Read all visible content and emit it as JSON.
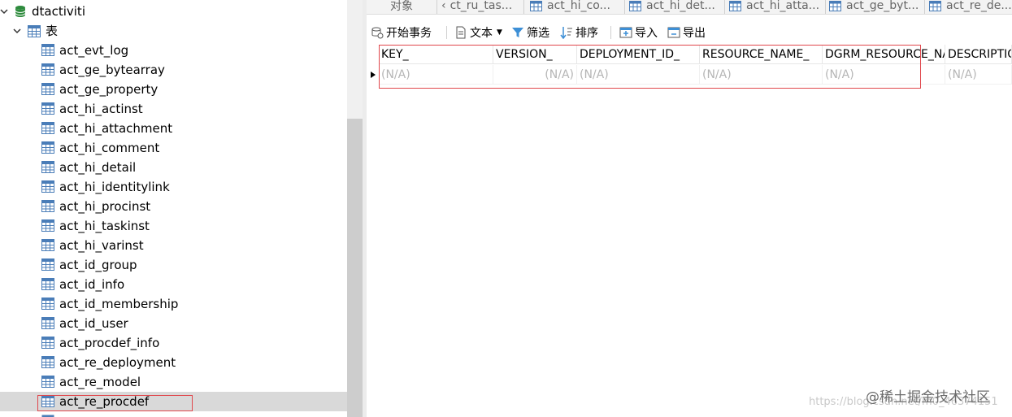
{
  "tree": {
    "database": "dtactiviti",
    "folder": "表",
    "tables": [
      "act_evt_log",
      "act_ge_bytearray",
      "act_ge_property",
      "act_hi_actinst",
      "act_hi_attachment",
      "act_hi_comment",
      "act_hi_detail",
      "act_hi_identitylink",
      "act_hi_procinst",
      "act_hi_taskinst",
      "act_hi_varinst",
      "act_id_group",
      "act_id_info",
      "act_id_membership",
      "act_id_user",
      "act_procdef_info",
      "act_re_deployment",
      "act_re_model",
      "act_re_procdef"
    ],
    "selected": "act_re_procdef"
  },
  "tabs": [
    "对象",
    "ct_ru_tas...",
    "act_hi_co...",
    "act_hi_det...",
    "act_hi_atta...",
    "act_ge_byt...",
    "act_re_de..."
  ],
  "toolbar": {
    "begin_transaction": "开始事务",
    "text": "文本",
    "filter": "筛选",
    "sort": "排序",
    "import": "导入",
    "export": "导出"
  },
  "grid": {
    "columns": [
      "KEY_",
      "VERSION_",
      "DEPLOYMENT_ID_",
      "RESOURCE_NAME_",
      "DGRM_RESOURCE_NAME_",
      "DESCRIPTION_"
    ],
    "row": [
      "(N/A)",
      "(N/A)",
      "(N/A)",
      "(N/A)",
      "(N/A)",
      "(N/A)"
    ]
  },
  "watermark": "@稀土掘金技术社区",
  "watermark_url": "https://blog.csdn.net/m0_46374151",
  "colors": {
    "highlight_box": "#e0474c",
    "db_icon": "#2e8b3d",
    "table_icon": "#4a7db8",
    "selected_row": "#d9d9d9"
  }
}
